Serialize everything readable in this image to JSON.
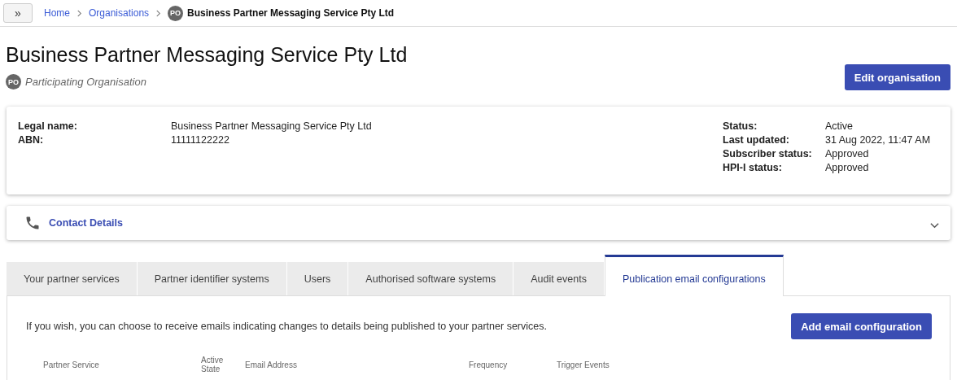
{
  "breadcrumb": {
    "toggle": "»",
    "items": [
      {
        "label": "Home"
      },
      {
        "label": "Organisations"
      }
    ],
    "current_badge": "PO",
    "current": "Business Partner Messaging Service Pty Ltd"
  },
  "header": {
    "title": "Business Partner Messaging Service Pty Ltd",
    "badge": "PO",
    "subtitle": "Participating Organisation",
    "edit_button": "Edit organisation"
  },
  "details": {
    "left": [
      {
        "label": "Legal name:",
        "value": "Business Partner Messaging Service Pty Ltd"
      },
      {
        "label": "ABN:",
        "value": "11111122222"
      }
    ],
    "right": [
      {
        "label": "Status:",
        "value": "Active"
      },
      {
        "label": "Last updated:",
        "value": "31 Aug 2022, 11:47 AM"
      },
      {
        "label": "Subscriber status:",
        "value": "Approved"
      },
      {
        "label": "HPI-I status:",
        "value": "Approved"
      }
    ]
  },
  "contact": {
    "title": "Contact Details",
    "expanded": false
  },
  "tabs": [
    {
      "label": "Your partner services",
      "selected": false
    },
    {
      "label": "Partner identifier systems",
      "selected": false
    },
    {
      "label": "Users",
      "selected": false
    },
    {
      "label": "Authorised software systems",
      "selected": false
    },
    {
      "label": "Audit events",
      "selected": false
    },
    {
      "label": "Publication email configurations",
      "selected": true
    }
  ],
  "panel": {
    "intro": "If you wish, you can choose to receive emails indicating changes to details being published to your partner services.",
    "add_button": "Add email configuration",
    "columns": [
      "Partner Service",
      "Active State",
      "Email Address",
      "Frequency",
      "Trigger Events"
    ]
  }
}
